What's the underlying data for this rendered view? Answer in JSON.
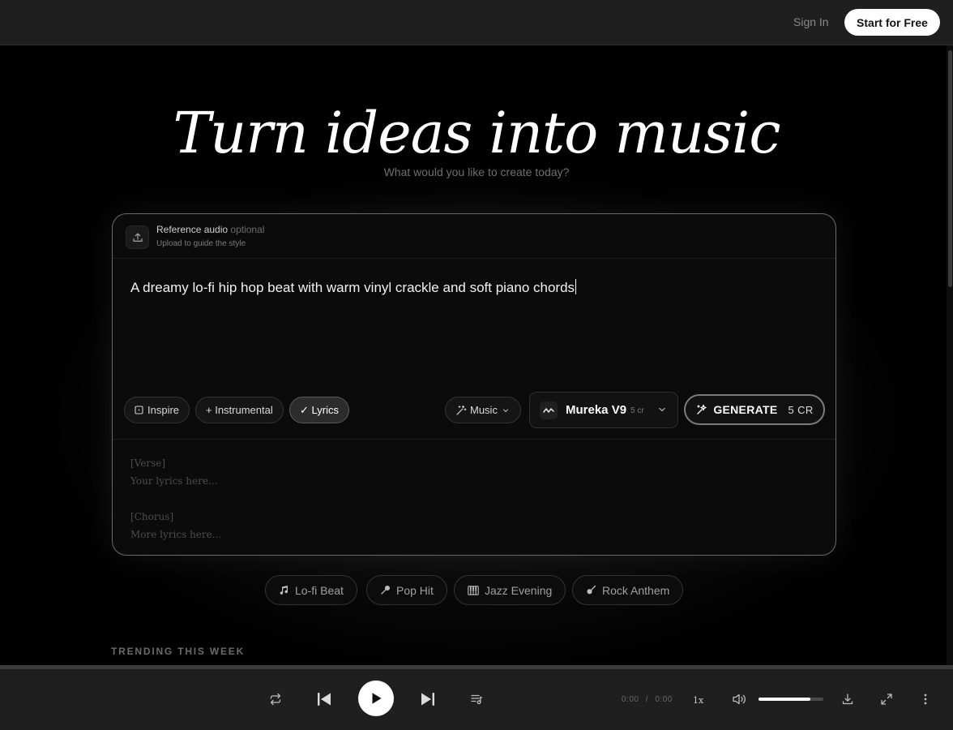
{
  "header": {
    "signin_label": "Sign In",
    "start_label": "Start for Free"
  },
  "hero": {
    "title": "Turn ideas into music",
    "subtitle": "What would you like to create today?"
  },
  "reference": {
    "title": "Reference audio",
    "optional": "optional",
    "subtitle": "Upload to guide the style",
    "icon": "upload-icon"
  },
  "prompt": {
    "value": "A dreamy lo-fi hip hop beat with warm vinyl crackle and soft piano chords"
  },
  "chips": {
    "inspire": "Inspire",
    "instrumental": "+ Instrumental",
    "lyrics": "✓ Lyrics",
    "lyrics_active": true
  },
  "mode": {
    "label": "Music"
  },
  "model": {
    "name": "Mureka V9",
    "credits": "5 cr"
  },
  "generate": {
    "label": "GENERATE",
    "credits": "5 CR"
  },
  "lyrics_placeholder": {
    "verse_tag": "[Verse]",
    "verse_line": "Your lyrics here...",
    "chorus_tag": "[Chorus]",
    "chorus_line": "More lyrics here..."
  },
  "suggestions": [
    {
      "label": "Lo-fi Beat",
      "icon": "music-note-icon"
    },
    {
      "label": "Pop Hit",
      "icon": "microphone-icon"
    },
    {
      "label": "Jazz Evening",
      "icon": "piano-icon"
    },
    {
      "label": "Rock Anthem",
      "icon": "guitar-icon"
    }
  ],
  "trending": {
    "heading": "TRENDING THIS WEEK"
  },
  "player": {
    "current_time": "0:00",
    "separator": "/",
    "duration": "0:00",
    "speed": "1x",
    "volume": 0.8
  },
  "colors": {
    "background": "#000000",
    "header": "#1f1f1f",
    "accent": "#ffffff",
    "player": "#1f1f1f"
  }
}
